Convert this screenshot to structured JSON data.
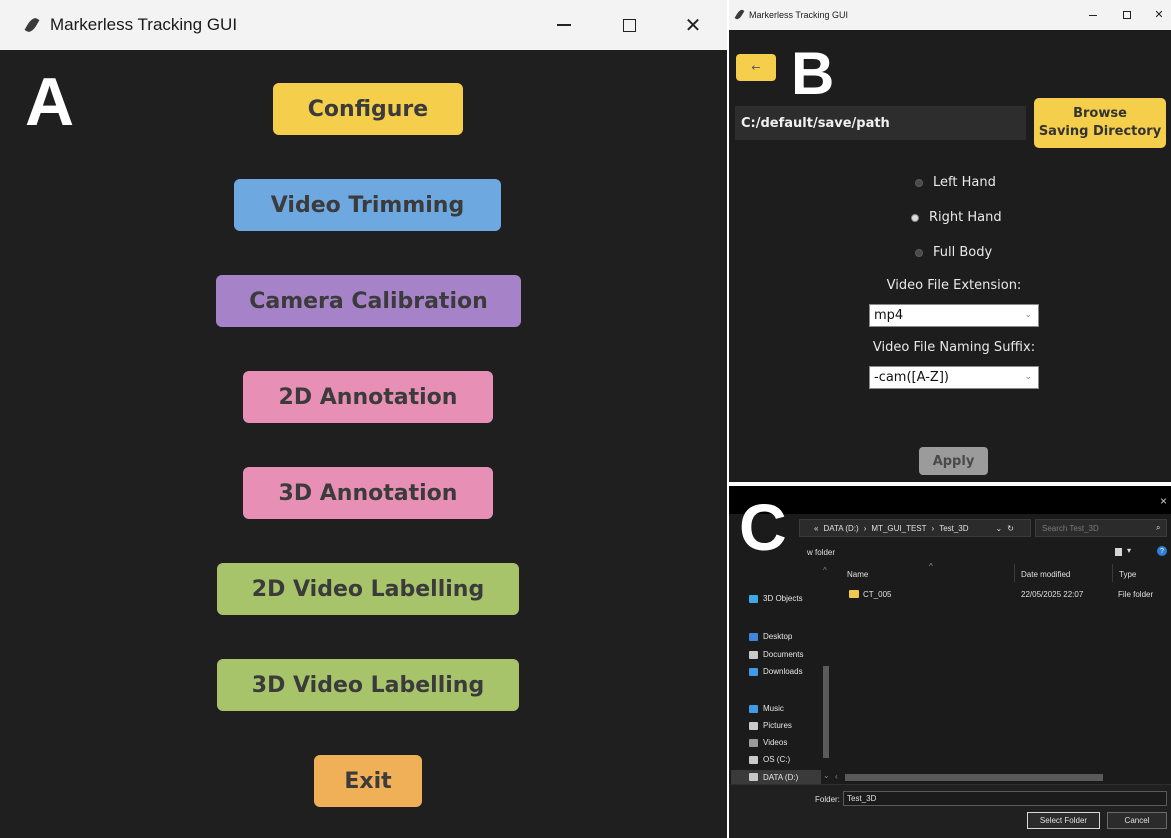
{
  "panel_a": {
    "letter": "A",
    "window_title": "Markerless Tracking GUI",
    "close_glyph": "✕",
    "buttons": [
      {
        "label": "Configure",
        "color": "#f5cf4b"
      },
      {
        "label": "Video Trimming",
        "color": "#6ea8e0"
      },
      {
        "label": "Camera Calibration",
        "color": "#a682c9"
      },
      {
        "label": "2D Annotation",
        "color": "#e88fb6"
      },
      {
        "label": "3D Annotation",
        "color": "#e88fb6"
      },
      {
        "label": "2D Video Labelling",
        "color": "#a7c46a"
      },
      {
        "label": "3D Video Labelling",
        "color": "#a7c46a"
      },
      {
        "label": "Exit",
        "color": "#f0b058"
      }
    ]
  },
  "panel_b": {
    "letter": "B",
    "window_title": "Markerless Tracking GUI",
    "back_glyph": "←",
    "close_glyph": "✕",
    "save_path": "C:/default/save/path",
    "browse_line1": "Browse",
    "browse_line2": "Saving Directory",
    "radio_options": [
      {
        "label": "Left Hand",
        "selected": false
      },
      {
        "label": "Right Hand",
        "selected": true
      },
      {
        "label": "Full Body",
        "selected": false
      }
    ],
    "extension_label": "Video File Extension:",
    "extension_value": "mp4",
    "suffix_label": "Video File Naming Suffix:",
    "suffix_value": "-cam([A-Z])",
    "apply_label": "Apply",
    "accent": "#f5cf4b"
  },
  "panel_c": {
    "letter": "C",
    "close_glyph": "×",
    "breadcrumb": [
      "«",
      "DATA (D:)",
      "›",
      "MT_GUI_TEST",
      "›",
      "Test_3D"
    ],
    "search_placeholder": "Search Test_3D",
    "new_folder_label": "w folder",
    "columns": {
      "name": "Name",
      "date": "Date modified",
      "type": "Type"
    },
    "rows": [
      {
        "name": "CT_005",
        "date": "22/05/2025 22:07",
        "type": "File folder"
      }
    ],
    "nav_items": [
      {
        "label": "3D Objects",
        "icon": "3d-objects-icon",
        "color": "#3fa9e8"
      },
      {
        "label": "Desktop",
        "icon": "desktop-icon",
        "color": "#3f86d8"
      },
      {
        "label": "Documents",
        "icon": "documents-icon",
        "color": "#c9c9c9"
      },
      {
        "label": "Downloads",
        "icon": "downloads-icon",
        "color": "#3f9be8"
      },
      {
        "label": "Music",
        "icon": "music-icon",
        "color": "#3f9be8"
      },
      {
        "label": "Pictures",
        "icon": "pictures-icon",
        "color": "#c9c9c9"
      },
      {
        "label": "Videos",
        "icon": "videos-icon",
        "color": "#9a9a9a"
      },
      {
        "label": "OS (C:)",
        "icon": "drive-c-icon",
        "color": "#c9c9c9"
      },
      {
        "label": "DATA (D:)",
        "icon": "drive-d-icon",
        "color": "#c9c9c9"
      }
    ],
    "folder_label": "Folder:",
    "folder_value": "Test_3D",
    "select_label": "Select Folder",
    "cancel_label": "Cancel"
  }
}
